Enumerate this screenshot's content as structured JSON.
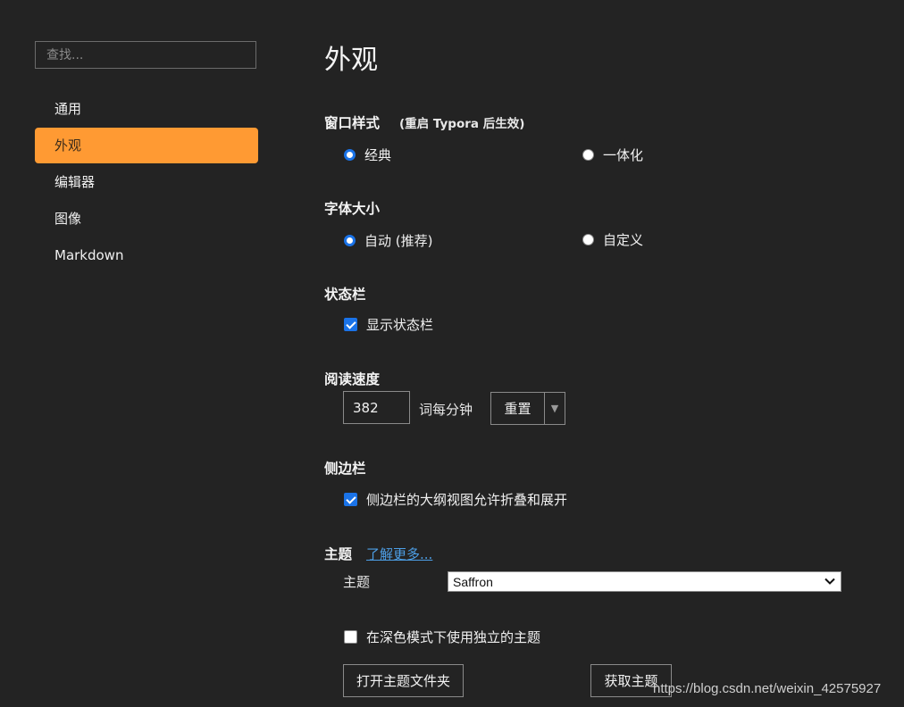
{
  "sidebar": {
    "search_placeholder": "查找...",
    "items": [
      {
        "label": "通用"
      },
      {
        "label": "外观"
      },
      {
        "label": "编辑器"
      },
      {
        "label": "图像"
      },
      {
        "label": "Markdown"
      }
    ],
    "active_index": 1
  },
  "main": {
    "title": "外观",
    "window_style": {
      "title": "窗口样式",
      "hint": "(重启 Typora 后生效)",
      "options": [
        "经典",
        "一体化"
      ],
      "selected": "经典"
    },
    "font_size": {
      "title": "字体大小",
      "options": [
        "自动 (推荐)",
        "自定义"
      ],
      "selected": "自动 (推荐)"
    },
    "status_bar": {
      "title": "状态栏",
      "checkbox_label": "显示状态栏",
      "checked": true
    },
    "reading_speed": {
      "title": "阅读速度",
      "value": "382",
      "unit": "词每分钟",
      "reset_label": "重置"
    },
    "sidebar_section": {
      "title": "侧边栏",
      "checkbox_label": "侧边栏的大纲视图允许折叠和展开",
      "checked": true
    },
    "theme": {
      "title": "主题",
      "learn_more": "了解更多...",
      "row_label": "主题",
      "selected": "Saffron",
      "dark_mode_label": "在深色模式下使用独立的主题",
      "dark_mode_checked": false,
      "open_folder_label": "打开主题文件夹",
      "get_themes_label": "获取主题"
    }
  },
  "watermark": "https://blog.csdn.net/weixin_42575927",
  "colors": {
    "background": "#232323",
    "accent": "#ff9a33",
    "link": "#4d9fe6",
    "control_blue": "#1a73e8"
  }
}
